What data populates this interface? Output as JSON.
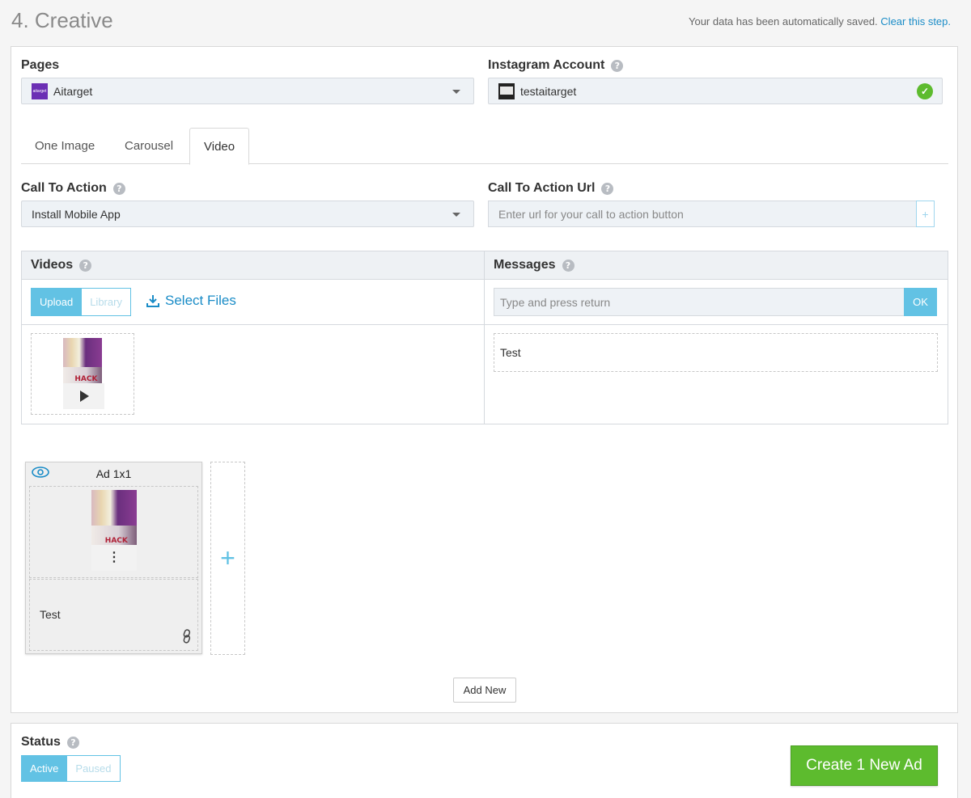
{
  "header": {
    "step_title": "4. Creative",
    "autosave_text": "Your data has been automatically saved.",
    "clear_link": "Clear this step."
  },
  "pages": {
    "label": "Pages",
    "selected": "Aitarget",
    "logo_text": "aitarget"
  },
  "instagram": {
    "label": "Instagram Account",
    "selected": "testaitarget"
  },
  "tabs": [
    {
      "label": "One Image"
    },
    {
      "label": "Carousel"
    },
    {
      "label": "Video"
    }
  ],
  "active_tab": "Video",
  "cta": {
    "label": "Call To Action",
    "selected": "Install Mobile App"
  },
  "cta_url": {
    "label": "Call To Action Url",
    "placeholder": "Enter url for your call to action button",
    "add_symbol": "+"
  },
  "videos": {
    "label": "Videos",
    "upload_label": "Upload",
    "library_label": "Library",
    "select_files_label": "Select Files"
  },
  "messages": {
    "label": "Messages",
    "placeholder": "Type and press return",
    "ok_label": "OK",
    "items": [
      "Test"
    ]
  },
  "ads": [
    {
      "title": "Ad 1x1",
      "message": "Test"
    }
  ],
  "add_slot_symbol": "+",
  "add_new_label": "Add New",
  "status": {
    "label": "Status",
    "active_label": "Active",
    "paused_label": "Paused",
    "selected": "Active"
  },
  "create_button_label": "Create 1 New Ad",
  "colors": {
    "accent": "#62c2e4",
    "link": "#1a8cc7",
    "success": "#5dbb2e"
  }
}
